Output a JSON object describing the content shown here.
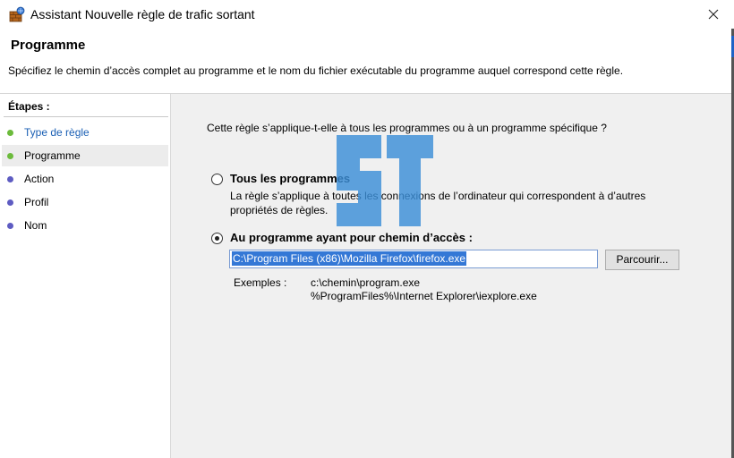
{
  "window": {
    "title": "Assistant Nouvelle règle de trafic sortant"
  },
  "header": {
    "title": "Programme",
    "description": "Spécifiez le chemin d’accès complet au programme et le nom du fichier exécutable du programme auquel correspond cette règle."
  },
  "sidebar": {
    "title": "Étapes :",
    "steps": [
      {
        "label": "Type de règle",
        "status": "done"
      },
      {
        "label": "Programme",
        "status": "current"
      },
      {
        "label": "Action",
        "status": "pending"
      },
      {
        "label": "Profil",
        "status": "pending"
      },
      {
        "label": "Nom",
        "status": "pending"
      }
    ]
  },
  "main": {
    "question": "Cette règle s’applique-t-elle à tous les programmes ou à un programme spécifique ?",
    "option_all": {
      "label": "Tous les programmes",
      "description": "La règle s’applique à toutes les connexions de l’ordinateur qui correspondent à d’autres propriétés de règles.",
      "selected": false
    },
    "option_path": {
      "label": "Au programme ayant pour chemin d’accès :",
      "selected": true,
      "path_value": "C:\\Program Files (x86)\\Mozilla Firefox\\firefox.exe"
    },
    "browse_label": "Parcourir...",
    "examples_label": "Exemples :",
    "examples": [
      "c:\\chemin\\program.exe",
      "%ProgramFiles%\\Internet Explorer\\iexplore.exe"
    ]
  },
  "colors": {
    "step_done": "#6cbb3c",
    "step_pending": "#5e5cc2",
    "selection": "#3478d6",
    "watermark": "#3c8fd8"
  },
  "icons": {
    "app": "firewall-icon",
    "close": "close-icon"
  }
}
